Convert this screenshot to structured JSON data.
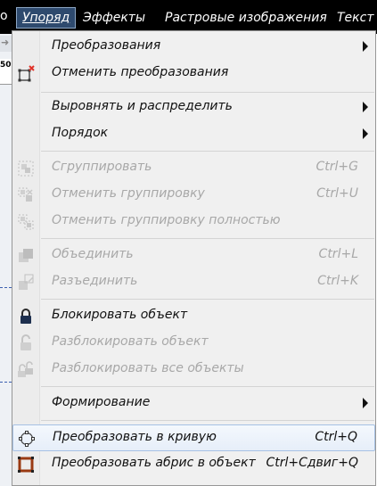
{
  "menubar": {
    "left_fragment": "о",
    "items": [
      {
        "label": "Упоряд"
      },
      {
        "label": "Эффекты"
      },
      {
        "label": "Растровые изображения"
      },
      {
        "label": "Текст"
      }
    ]
  },
  "background": {
    "ruler_value": "50"
  },
  "menu": {
    "items": [
      {
        "label": "Преобразования",
        "submenu": true
      },
      {
        "label": "Отменить преобразования",
        "icon": "clear-transformations-icon"
      },
      {
        "label": "Выровнять и распределить",
        "submenu": true
      },
      {
        "label": "Порядок",
        "submenu": true
      },
      {
        "label": "Сгруппировать",
        "shortcut": "Ctrl+G",
        "disabled": true,
        "icon": "group-icon"
      },
      {
        "label": "Отменить группировку",
        "shortcut": "Ctrl+U",
        "disabled": true,
        "icon": "ungroup-icon"
      },
      {
        "label": "Отменить группировку полностью",
        "disabled": true,
        "icon": "ungroup-all-icon"
      },
      {
        "label": "Объединить",
        "shortcut": "Ctrl+L",
        "disabled": true,
        "icon": "combine-icon"
      },
      {
        "label": "Разъединить",
        "shortcut": "Ctrl+K",
        "disabled": true,
        "icon": "break-apart-icon"
      },
      {
        "label": "Блокировать объект",
        "icon": "lock-icon"
      },
      {
        "label": "Разблокировать объект",
        "disabled": true,
        "icon": "unlock-icon"
      },
      {
        "label": "Разблокировать все объекты",
        "disabled": true,
        "icon": "unlock-all-icon"
      },
      {
        "label": "Формирование",
        "submenu": true
      },
      {
        "label": "Преобразовать в кривую",
        "shortcut": "Ctrl+Q",
        "highlighted": true,
        "icon": "convert-to-curves-icon"
      },
      {
        "label": "Преобразовать абрис в объект",
        "shortcut": "Ctrl+Сдвиг+Q",
        "icon": "outline-to-object-icon"
      }
    ]
  }
}
